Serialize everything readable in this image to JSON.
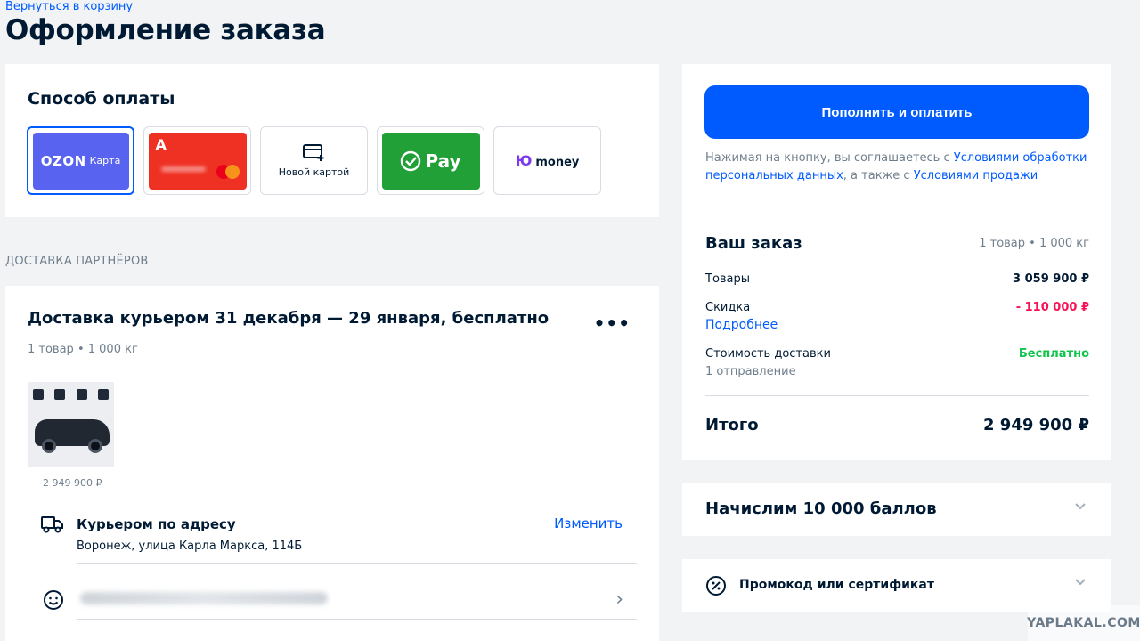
{
  "header": {
    "back_link": "Вернуться в корзину",
    "title": "Оформление заказа"
  },
  "payment": {
    "title": "Способ оплаты",
    "methods": [
      {
        "brand": "OZON",
        "sub": "Карта",
        "selected": true
      },
      {
        "letter": "А",
        "icon": "mastercard-icon"
      },
      {
        "label": "Новой картой",
        "icon": "add-card-icon"
      },
      {
        "label": "Pay",
        "icon": "check-circle-icon"
      },
      {
        "label": "money",
        "mark": "Ю"
      }
    ]
  },
  "delivery": {
    "section_label": "ДОСТАВКА ПАРТНЁРОВ",
    "title": "Доставка курьером 31 декабря — 29 января, бесплатно",
    "more": "•••",
    "meta": "1 товар • 1 000 кг",
    "product_price": "2 949 900 ₽",
    "courier_title": "Курьером по адресу",
    "courier_address": "Воронеж, улица Карла Маркса, 114Б",
    "change_link": "Изменить"
  },
  "sidebar": {
    "pay_button": "Пополнить и оплатить",
    "terms_1": "Нажимая на кнопку, вы соглашаетесь с ",
    "terms_link_1": "Условиями обработки персональных данных",
    "terms_2": ", а также с ",
    "terms_link_2": "Условиями продажи",
    "order_title": "Ваш заказ",
    "order_meta": "1 товар • 1 000 кг",
    "goods_label": "Товары",
    "goods_value": "3 059 900 ₽",
    "discount_label": "Скидка",
    "discount_value": "- 110 000 ₽",
    "discount_more": "Подробнее",
    "shipping_label": "Стоимость доставки",
    "shipping_sub": "1 отправление",
    "shipping_value": "Бесплатно",
    "total_label": "Итого",
    "total_value": "2 949 900 ₽",
    "points_title": "Начислим 10 000 баллов",
    "promo_title": "Промокод или сертификат"
  },
  "watermark": "YAPLAKAL.COM",
  "colors": {
    "accent": "#005bff",
    "discount": "#f91155",
    "free": "#10c44c",
    "text": "#001a34",
    "muted": "#707f8d"
  }
}
